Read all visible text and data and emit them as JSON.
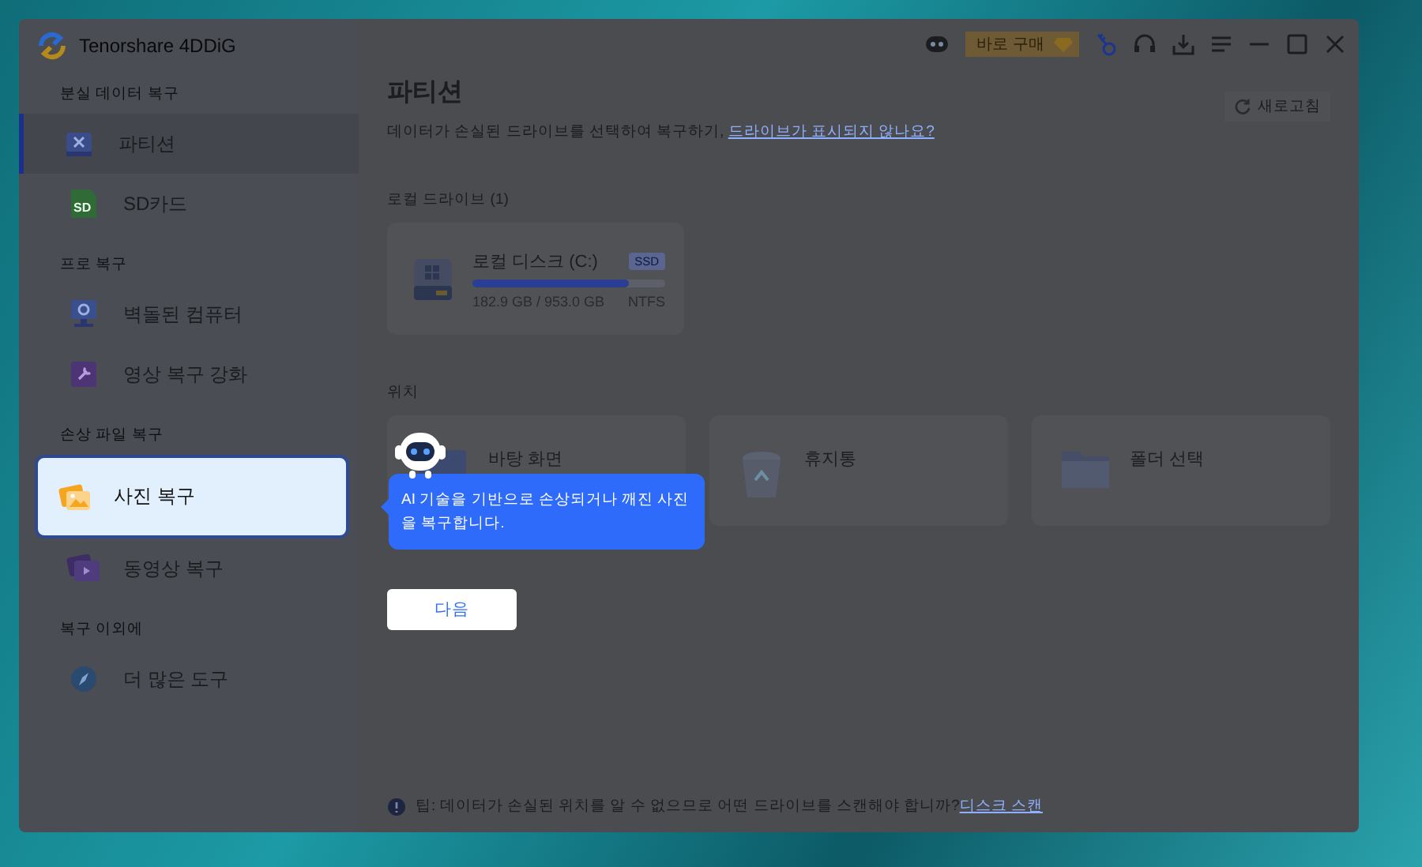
{
  "window": {
    "title": "Tenorshare 4DDiG"
  },
  "sidebar": {
    "sections": [
      {
        "heading": "분실 데이터 복구",
        "items": [
          {
            "label": "파티션",
            "kind": "partition",
            "selected": true,
            "highlighted": false
          },
          {
            "label": "SD카드",
            "kind": "sd",
            "icon_text": "SD",
            "selected": false,
            "highlighted": false
          }
        ]
      },
      {
        "heading": "프로 복구",
        "items": [
          {
            "label": "벽돌된 컴퓨터",
            "kind": "computer",
            "selected": false,
            "highlighted": false
          },
          {
            "label": "영상 복구 강화",
            "kind": "repair",
            "selected": false,
            "highlighted": false
          }
        ]
      },
      {
        "heading": "손상 파일 복구",
        "items": [
          {
            "label": "사진 복구",
            "kind": "photo",
            "selected": false,
            "highlighted": true
          },
          {
            "label": "동영상 복구",
            "kind": "video",
            "selected": false,
            "highlighted": false
          }
        ]
      },
      {
        "heading": "복구 이외에",
        "items": [
          {
            "label": "더 많은 도구",
            "kind": "tools",
            "selected": false,
            "highlighted": false
          }
        ]
      }
    ]
  },
  "toolbar": {
    "buy_button": "바로 구매"
  },
  "main": {
    "title": "파티션",
    "subtitle": "데이터가 손실된 드라이브를 선택하여 복구하기, ",
    "subtitle_link": "드라이브가 표시되지 않나요?",
    "refresh_button": "새로고침",
    "local_heading": "로컬 드라이브 (1)",
    "drives": [
      {
        "name": "로컬 디스크 (C:)",
        "type": "SSD",
        "usage": "182.9 GB / 953.0 GB",
        "filesystem": "NTFS",
        "level": 0.81
      }
    ],
    "locations_heading": "위치",
    "locations": [
      {
        "label": "바탕 화면",
        "kind": "desktop"
      },
      {
        "label": "휴지통",
        "kind": "trash"
      },
      {
        "label": "폴더 선택",
        "kind": "folder"
      }
    ],
    "tooltip": "AI 기술을 기반으로 손상되거나 깨진 사진을 복구합니다.",
    "next_button": "다음",
    "tip": "팁: 데이터가 손실된 위치를 알 수 없으므로 어떤 드라이브를 스캔해야 합니까?",
    "tip_link": "디스크 스캔"
  }
}
